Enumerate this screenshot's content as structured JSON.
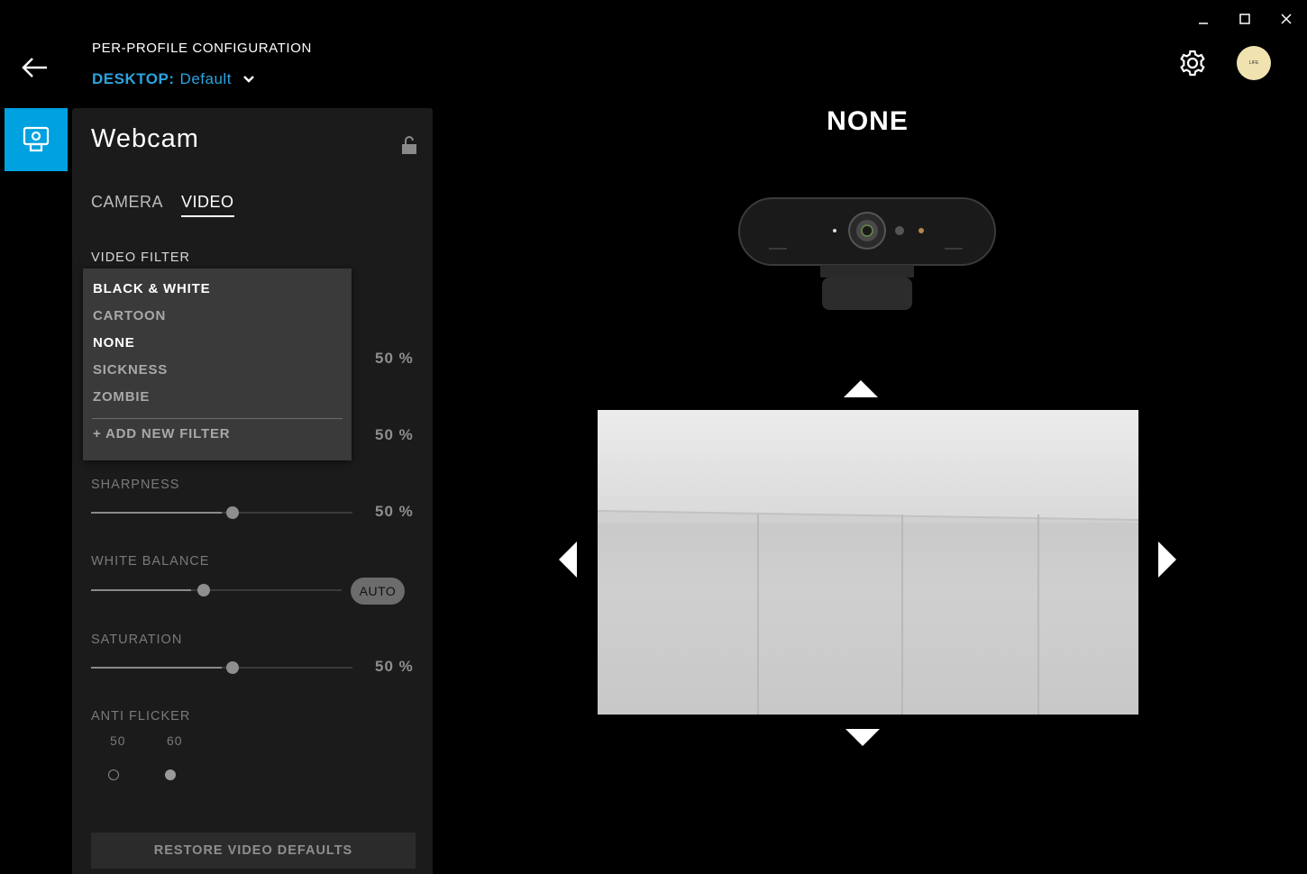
{
  "window": {
    "controls": [
      "minimize",
      "maximize",
      "close"
    ]
  },
  "header": {
    "section_title": "PER-PROFILE CONFIGURATION",
    "profile_scope": "DESKTOP:",
    "profile_name": "Default",
    "avatar_text": "LIFE"
  },
  "panel": {
    "title": "Webcam",
    "tabs": [
      {
        "label": "CAMERA",
        "active": false
      },
      {
        "label": "VIDEO",
        "active": true
      }
    ],
    "video_filter": {
      "label": "VIDEO FILTER",
      "options": [
        {
          "label": "BLACK & WHITE",
          "highlight": true
        },
        {
          "label": "CARTOON",
          "highlight": false
        },
        {
          "label": "NONE",
          "highlight": true,
          "selected": true
        },
        {
          "label": "SICKNESS",
          "highlight": false
        },
        {
          "label": "ZOMBIE",
          "highlight": false
        }
      ],
      "add_new_label": "+ ADD NEW FILTER"
    },
    "hidden_slider_1": {
      "value_text": "50 %"
    },
    "hidden_slider_2": {
      "value_text": "50 %"
    },
    "sharpness": {
      "label": "SHARPNESS",
      "value": 50,
      "value_text": "50 %"
    },
    "white_balance": {
      "label": "WHITE BALANCE",
      "value": 45,
      "auto_label": "AUTO"
    },
    "saturation": {
      "label": "SATURATION",
      "value": 50,
      "value_text": "50 %"
    },
    "anti_flicker": {
      "label": "ANTI FLICKER",
      "options": [
        {
          "label": "50",
          "selected": false
        },
        {
          "label": "60",
          "selected": true
        }
      ]
    },
    "restore_label": "RESTORE VIDEO DEFAULTS"
  },
  "preview": {
    "filter_name": "NONE"
  },
  "colors": {
    "accent": "#00a1e0",
    "profile_text": "#2aa4e0",
    "panel_bg": "#1b1b1b",
    "dropdown_bg": "#3a3a3a"
  }
}
